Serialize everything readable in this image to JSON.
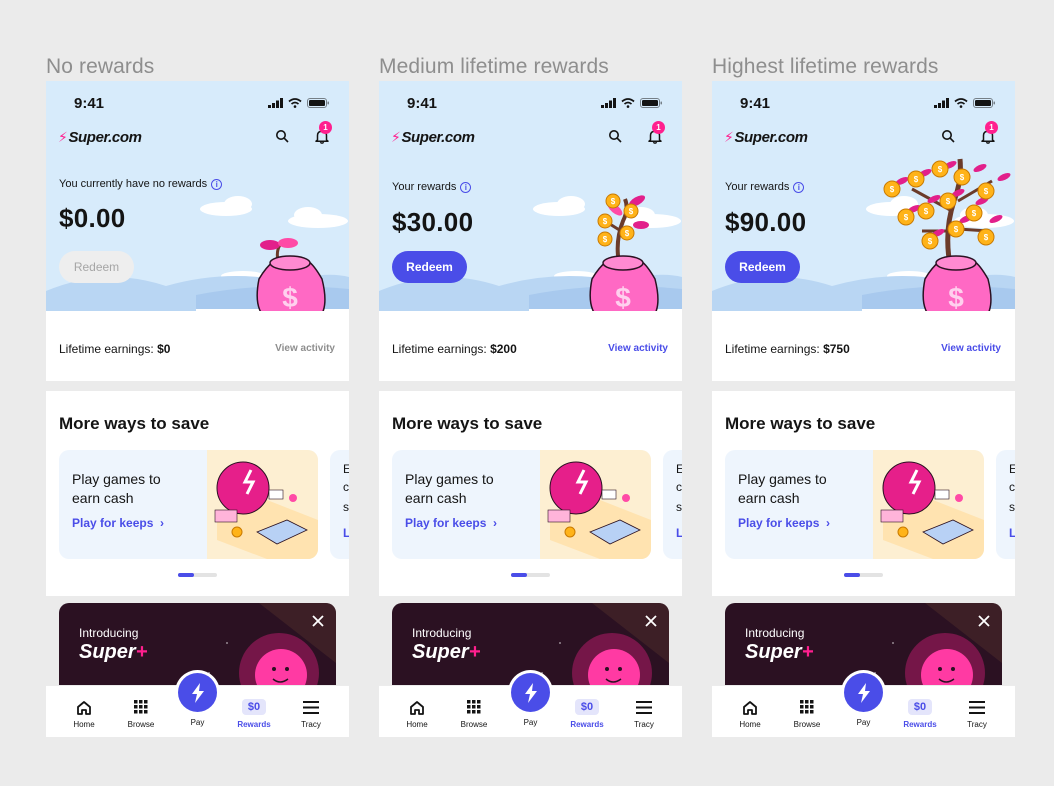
{
  "brand": {
    "name": "Super.com",
    "accent": "#4a4de8",
    "pink": "#ff1f8e"
  },
  "variants": [
    {
      "column_title": "No rewards",
      "status_time": "9:41",
      "notification_count": "1",
      "rewards_label": "You currently have no rewards",
      "amount": "$0.00",
      "redeem_label": "Redeem",
      "redeem_state": "disabled",
      "lifetime_label": "Lifetime earnings: ",
      "lifetime_value": "$0",
      "view_activity": "View activity",
      "view_activity_state": "muted",
      "illustration": "money-bag-sprout"
    },
    {
      "column_title": "Medium lifetime rewards",
      "status_time": "9:41",
      "notification_count": "1",
      "rewards_label": "Your rewards",
      "amount": "$30.00",
      "redeem_label": "Redeem",
      "redeem_state": "enabled",
      "lifetime_label": "Lifetime earnings: ",
      "lifetime_value": "$200",
      "view_activity": "View activity",
      "view_activity_state": "link",
      "illustration": "money-bag-small-tree"
    },
    {
      "column_title": "Highest lifetime rewards",
      "status_time": "9:41",
      "notification_count": "1",
      "rewards_label": "Your rewards",
      "amount": "$90.00",
      "redeem_label": "Redeem",
      "redeem_state": "enabled",
      "lifetime_label": "Lifetime earnings: ",
      "lifetime_value": "$750",
      "view_activity": "View activity",
      "view_activity_state": "link",
      "illustration": "money-bag-big-tree"
    }
  ],
  "save_section": {
    "title": "More ways to save",
    "card_title": "Play games to earn cash",
    "card_link": "Play for keeps",
    "peek_card_letters": [
      "E",
      "c",
      "s",
      "L"
    ],
    "carousel_position": "1"
  },
  "promo": {
    "small": "Introducing",
    "big": "Super",
    "plus": "+"
  },
  "tabs": [
    {
      "label": "Home",
      "icon": "home-icon"
    },
    {
      "label": "Browse",
      "icon": "grid-icon"
    },
    {
      "label": "Pay",
      "icon": "bolt-icon"
    },
    {
      "label": "Rewards",
      "icon": "rewards-chip",
      "chip": "$0"
    },
    {
      "label": "Tracy",
      "icon": "menu-icon"
    }
  ]
}
